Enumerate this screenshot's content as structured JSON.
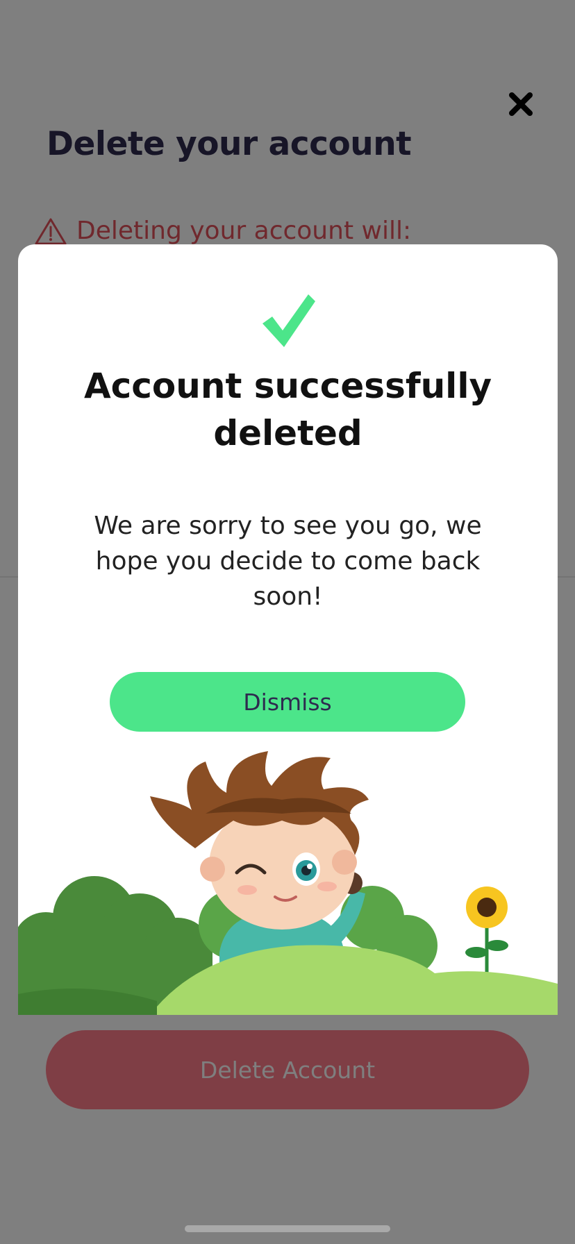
{
  "page": {
    "title": "Delete your account",
    "warning_text": "Deleting your account will:",
    "delete_button_label": "Delete Account"
  },
  "modal": {
    "title": "Account successfully deleted",
    "message": "We are sorry to see you go, we hope you decide to come back soon!",
    "dismiss_label": "Dismiss"
  },
  "icons": {
    "close": "close-icon",
    "warning": "warning-icon",
    "success": "checkmark-icon"
  },
  "colors": {
    "title": "#2e2a4f",
    "warning": "#e0505a",
    "delete_button": "#ff7d8a",
    "dismiss_button": "#4ce58a",
    "checkmark": "#4ce58a",
    "overlay": "rgba(0,0,0,0.5)"
  }
}
